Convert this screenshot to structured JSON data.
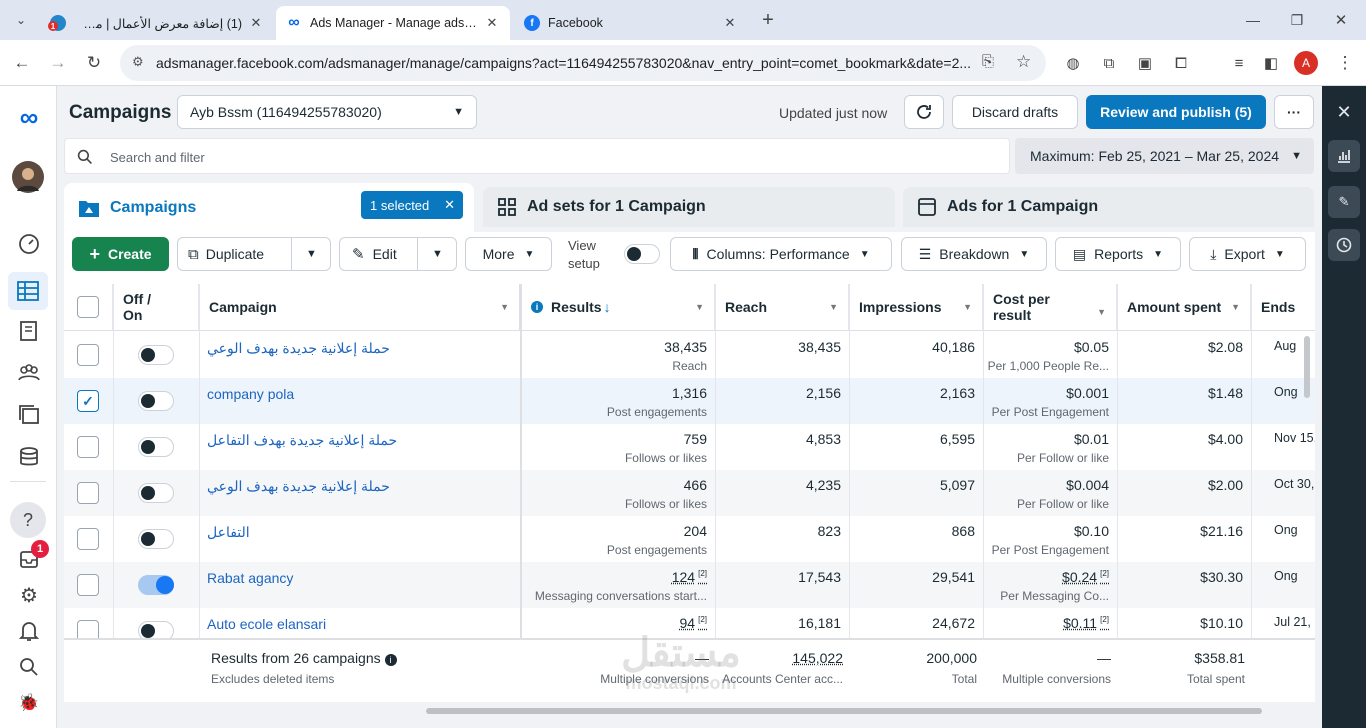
{
  "browser": {
    "tabs": [
      {
        "title": "(1) إضافة معرض الأعمال | مستقل",
        "badge": "1"
      },
      {
        "title": "Ads Manager - Manage ads - C"
      },
      {
        "title": "Facebook"
      }
    ],
    "url": "adsmanager.facebook.com/adsmanager/manage/campaigns?act=116494255783020&nav_entry_point=comet_bookmark&date=2...",
    "profile_initial": "A"
  },
  "header": {
    "title": "Campaigns",
    "account": "Ayb Bssm (116494255783020)",
    "updated": "Updated just now",
    "discard": "Discard drafts",
    "review": "Review and publish (5)",
    "more": "···"
  },
  "search": {
    "placeholder": "Search and filter",
    "date_range": "Maximum: Feb 25, 2021 – Mar 25, 2024"
  },
  "tabs": {
    "campaigns": "Campaigns",
    "selected": "1 selected",
    "adsets": "Ad sets for 1 Campaign",
    "ads": "Ads for 1 Campaign"
  },
  "toolbar": {
    "create": "Create",
    "duplicate": "Duplicate",
    "edit": "Edit",
    "more": "More",
    "view_setup_1": "View",
    "view_setup_2": "setup",
    "columns": "Columns: Performance",
    "breakdown": "Breakdown",
    "reports": "Reports",
    "export": "Export"
  },
  "columns": {
    "offon_1": "Off /",
    "offon_2": "On",
    "campaign": "Campaign",
    "results": "Results",
    "reach": "Reach",
    "impressions": "Impressions",
    "cpr_1": "Cost per",
    "cpr_2": "result",
    "spent": "Amount spent",
    "ends": "Ends"
  },
  "rows": [
    {
      "name": "حملة إعلانية جديدة بهدف الوعي",
      "on": false,
      "checked": false,
      "results": "38,435",
      "results_sub": "Reach",
      "reach": "38,435",
      "impressions": "40,186",
      "cpr": "$0.05",
      "cpr_sub": "Per 1,000 People Re...",
      "spent": "$2.08",
      "ends": "Aug"
    },
    {
      "name": "company pola",
      "on": false,
      "checked": true,
      "results": "1,316",
      "results_sub": "Post engagements",
      "reach": "2,156",
      "impressions": "2,163",
      "cpr": "$0.001",
      "cpr_sub": "Per Post Engagement",
      "spent": "$1.48",
      "ends": "Ong"
    },
    {
      "name": "حملة إعلانية جديدة بهدف التفاعل",
      "on": false,
      "checked": false,
      "results": "759",
      "results_sub": "Follows or likes",
      "reach": "4,853",
      "impressions": "6,595",
      "cpr": "$0.01",
      "cpr_sub": "Per Follow or like",
      "spent": "$4.00",
      "ends": "Nov 15,"
    },
    {
      "name": "حملة إعلانية جديدة بهدف الوعي",
      "on": false,
      "checked": false,
      "results": "466",
      "results_sub": "Follows or likes",
      "reach": "4,235",
      "impressions": "5,097",
      "cpr": "$0.004",
      "cpr_sub": "Per Follow or like",
      "spent": "$2.00",
      "ends": "Oct 30,"
    },
    {
      "name": "التفاعل",
      "on": false,
      "checked": false,
      "results": "204",
      "results_sub": "Post engagements",
      "reach": "823",
      "impressions": "868",
      "cpr": "$0.10",
      "cpr_sub": "Per Post Engagement",
      "spent": "$21.16",
      "ends": "Ong"
    },
    {
      "name": "Rabat agancy",
      "on": true,
      "checked": false,
      "results": "124",
      "results_sup": "[2]",
      "results_sub": "Messaging conversations start...",
      "reach": "17,543",
      "impressions": "29,541",
      "cpr": "$0.24",
      "cpr_sup": "[2]",
      "cpr_sub": "Per Messaging Co...",
      "spent": "$30.30",
      "ends": "Ong"
    },
    {
      "name": "Auto ecole elansari",
      "on": false,
      "checked": false,
      "results": "94",
      "results_sup": "[2]",
      "results_sub": "",
      "reach": "16,181",
      "impressions": "24,672",
      "cpr": "$0.11",
      "cpr_sup": "[2]",
      "cpr_sub": "",
      "spent": "$10.10",
      "ends": "Jul 21,"
    }
  ],
  "footer": {
    "label": "Results from 26 campaigns",
    "sub": "Excludes deleted items",
    "results": "—",
    "results_sub": "Multiple conversions",
    "reach": "145,022",
    "reach_sub": "Accounts Center acc...",
    "impressions": "200,000",
    "impressions_sub": "Total",
    "cpr": "—",
    "cpr_sub": "Multiple conversions",
    "spent": "$358.81",
    "spent_sub": "Total spent"
  },
  "watermark": {
    "ar": "مستقل",
    "en": "mostaql.com"
  },
  "notif_badge": "1"
}
